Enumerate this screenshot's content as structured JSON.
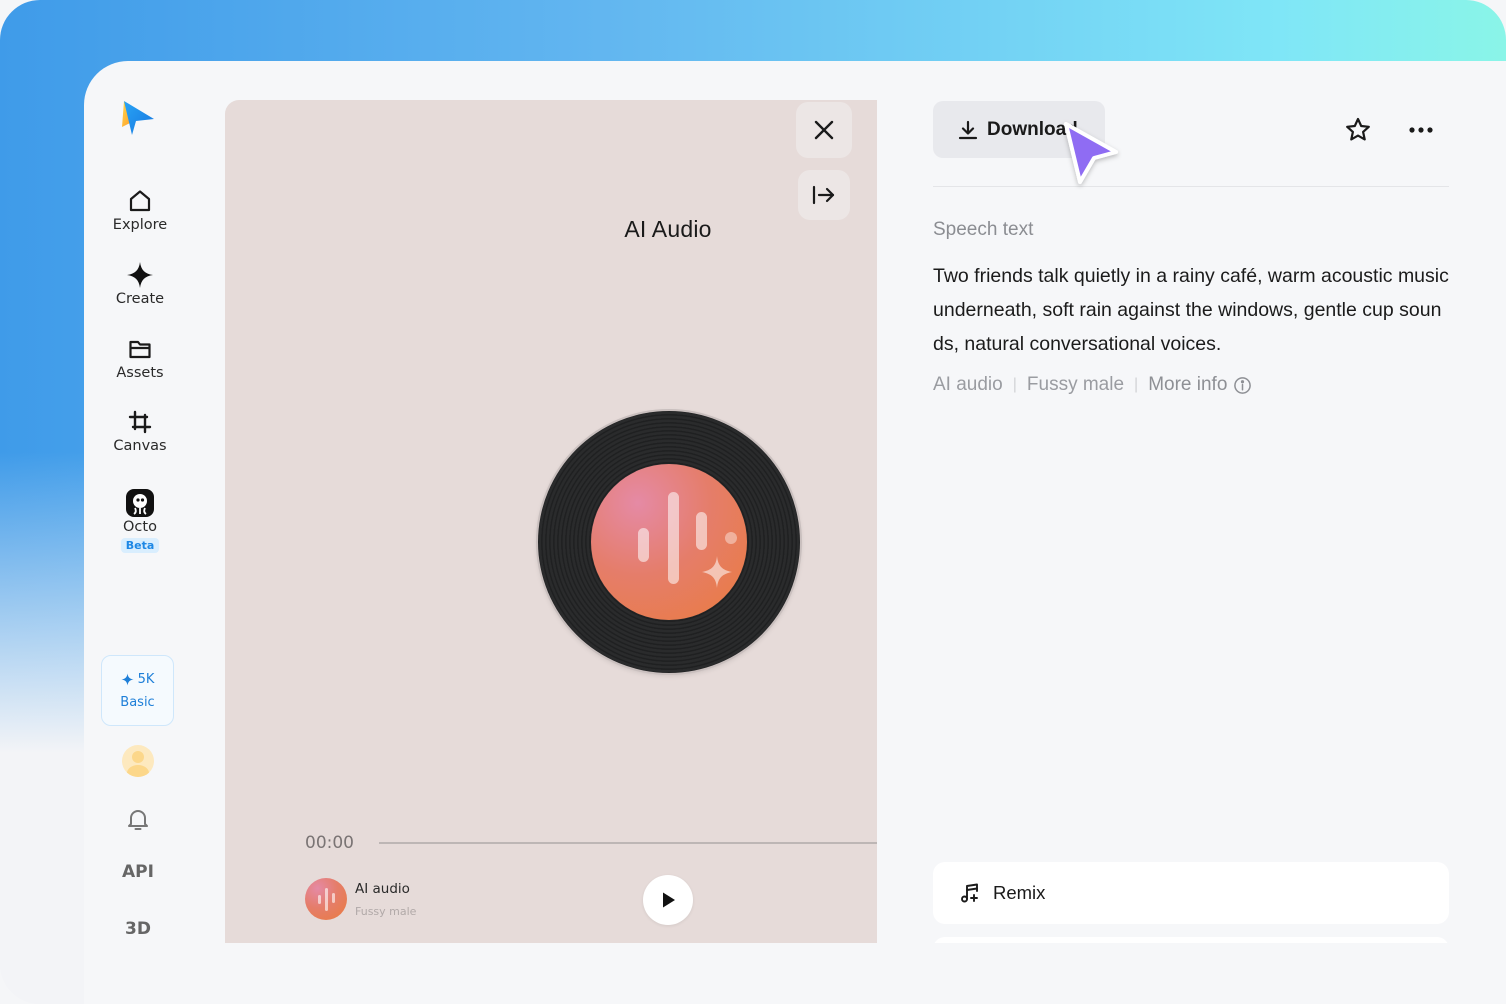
{
  "sidebar": {
    "nav": [
      {
        "label": "Explore",
        "icon": "home-icon"
      },
      {
        "label": "Create",
        "icon": "sparkle-icon"
      },
      {
        "label": "Assets",
        "icon": "folder-icon"
      },
      {
        "label": "Canvas",
        "icon": "canvas-grid-icon"
      },
      {
        "label": "Octo",
        "icon": "octo-icon",
        "badge": "Beta"
      }
    ],
    "credits": {
      "amount": "5K",
      "plan": "Basic"
    },
    "api_label": "API",
    "three_d_label": "3D"
  },
  "player": {
    "title": "AI Audio",
    "time": "00:00",
    "track_title": "AI audio",
    "track_voice": "Fussy male"
  },
  "details": {
    "download_label": "Download",
    "section_label": "Speech text",
    "speech_text": "Two friends talk quietly in a rainy café, warm acoustic music underneath, soft rain against the windows, gentle cup sounds, natural conversational voices.",
    "meta": {
      "type": "AI audio",
      "voice": "Fussy male",
      "more_info": "More info"
    },
    "remix_label": "Remix"
  },
  "colors": {
    "accent": "#1e88e5",
    "player_bg": "#e6dbd9",
    "cursor": "#8f6cf3"
  }
}
